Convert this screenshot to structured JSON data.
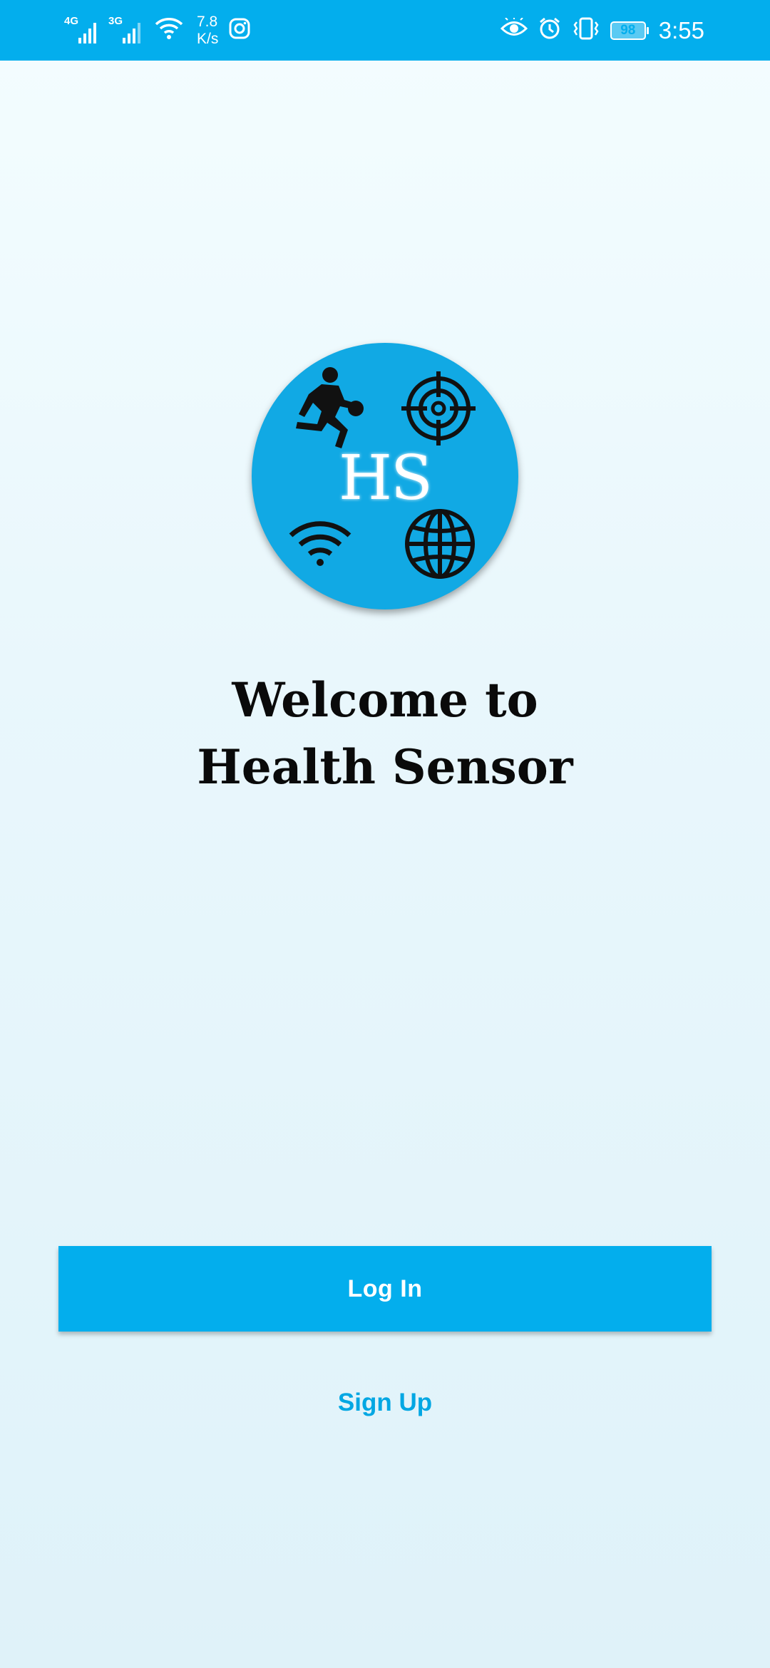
{
  "status_bar": {
    "network_1": "4G",
    "network_2": "3G",
    "speed_value": "7.8",
    "speed_unit": "K/s",
    "battery_level": "98",
    "time": "3:55",
    "background_color": "#03aeed",
    "icons": [
      "signal-icon",
      "signal-icon",
      "wifi-icon",
      "instagram-icon",
      "eye-comfort-icon",
      "alarm-icon",
      "vibrate-icon",
      "battery-icon"
    ]
  },
  "logo": {
    "text": "HS",
    "color": "#11a9e4",
    "icons": [
      "runner-icon",
      "target-icon",
      "wifi-icon",
      "globe-icon"
    ]
  },
  "welcome": {
    "line1": "Welcome to",
    "line2": "Health Sensor"
  },
  "actions": {
    "login_label": "Log In",
    "signup_label": "Sign Up",
    "accent_color": "#03aeed"
  }
}
